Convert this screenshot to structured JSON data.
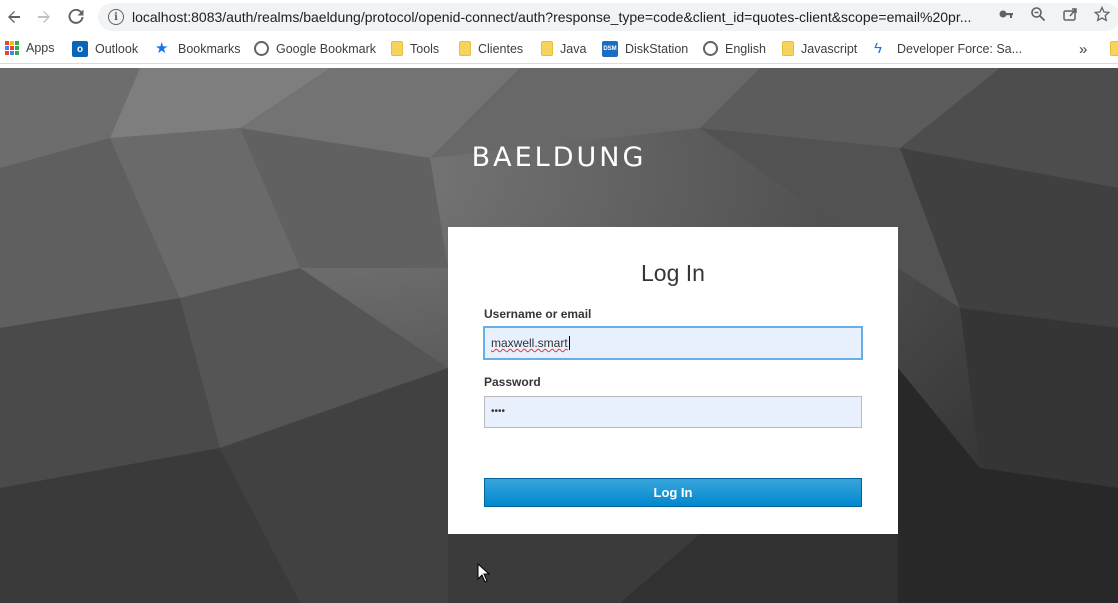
{
  "browser": {
    "url": "localhost:8083/auth/realms/baeldung/protocol/openid-connect/auth?response_type=code&client_id=quotes-client&scope=email%20pr...",
    "bookmarks": [
      {
        "label": "Apps",
        "icon": "apps-grid-icon"
      },
      {
        "label": "Outlook",
        "icon": "outlook-icon"
      },
      {
        "label": "Bookmarks",
        "icon": "star-icon"
      },
      {
        "label": "Google Bookmark",
        "icon": "globe-icon"
      },
      {
        "label": "Tools",
        "icon": "folder-icon"
      },
      {
        "label": "Clientes",
        "icon": "folder-icon"
      },
      {
        "label": "Java",
        "icon": "folder-icon"
      },
      {
        "label": "DiskStation",
        "icon": "dsm-icon"
      },
      {
        "label": "English",
        "icon": "globe-icon"
      },
      {
        "label": "Javascript",
        "icon": "folder-icon"
      },
      {
        "label": "Developer Force: Sa...",
        "icon": "bolt-icon"
      }
    ],
    "more_glyph": "»"
  },
  "page": {
    "brand": "BAELDUNG",
    "title": "Log In",
    "username_label": "Username or email",
    "username_value": "maxwell.smart",
    "password_label": "Password",
    "password_value": "••••",
    "submit_label": "Log In"
  },
  "colors": {
    "button": "#0088ce",
    "input_bg": "#e8f0fe",
    "focus": "#66afe9"
  }
}
